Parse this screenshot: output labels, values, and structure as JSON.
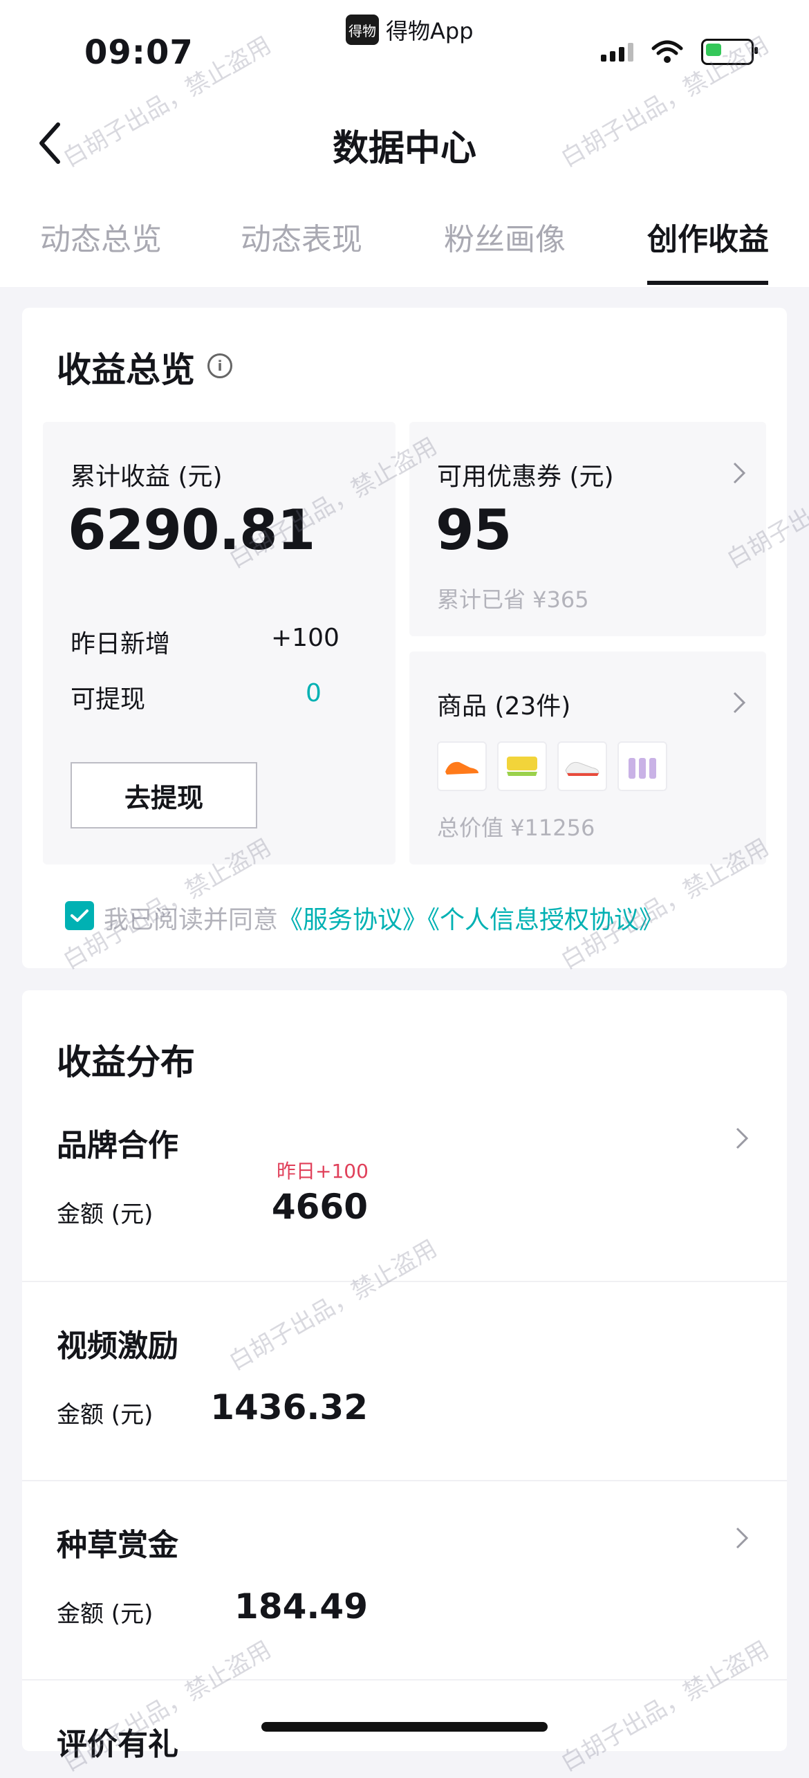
{
  "status_bar": {
    "time": "09:07",
    "app_name": "得物App",
    "app_logo_text": "得物"
  },
  "header": {
    "title": "数据中心"
  },
  "tabs": [
    {
      "label": "动态总览",
      "active": false
    },
    {
      "label": "动态表现",
      "active": false
    },
    {
      "label": "粉丝画像",
      "active": false
    },
    {
      "label": "创作收益",
      "active": true
    }
  ],
  "overview": {
    "title": "收益总览",
    "info_icon_glyph": "i",
    "cumulative": {
      "label": "累计收益 (元)",
      "value": "6290.81"
    },
    "yesterday": {
      "label": "昨日新增",
      "value": "+100"
    },
    "withdrawable": {
      "label": "可提现",
      "value": "0"
    },
    "withdraw_button": "去提现",
    "coupon": {
      "label": "可用优惠券 (元)",
      "value": "95",
      "saved": "累计已省 ¥365"
    },
    "goods": {
      "label": "商品 (23件)",
      "total": "总价值 ¥11256"
    },
    "agreement": {
      "prefix": "我已阅读并同意",
      "link1": "《服务协议》",
      "link2": "《个人信息授权协议》",
      "checked": true
    }
  },
  "distribution": {
    "title": "收益分布",
    "items": [
      {
        "name": "品牌合作",
        "label": "金额 (元)",
        "amount": "4660",
        "delta": "昨日+100"
      },
      {
        "name": "视频激励",
        "label": "金额 (元)",
        "amount": "1436.32"
      },
      {
        "name": "种草赏金",
        "label": "金额 (元)",
        "amount": "184.49"
      },
      {
        "name": "评价有礼"
      }
    ]
  },
  "watermark": "白胡子出品，禁止盗用",
  "colors": {
    "accent": "#00b1b3",
    "delta": "#e0405a",
    "battery": "#34c759"
  }
}
